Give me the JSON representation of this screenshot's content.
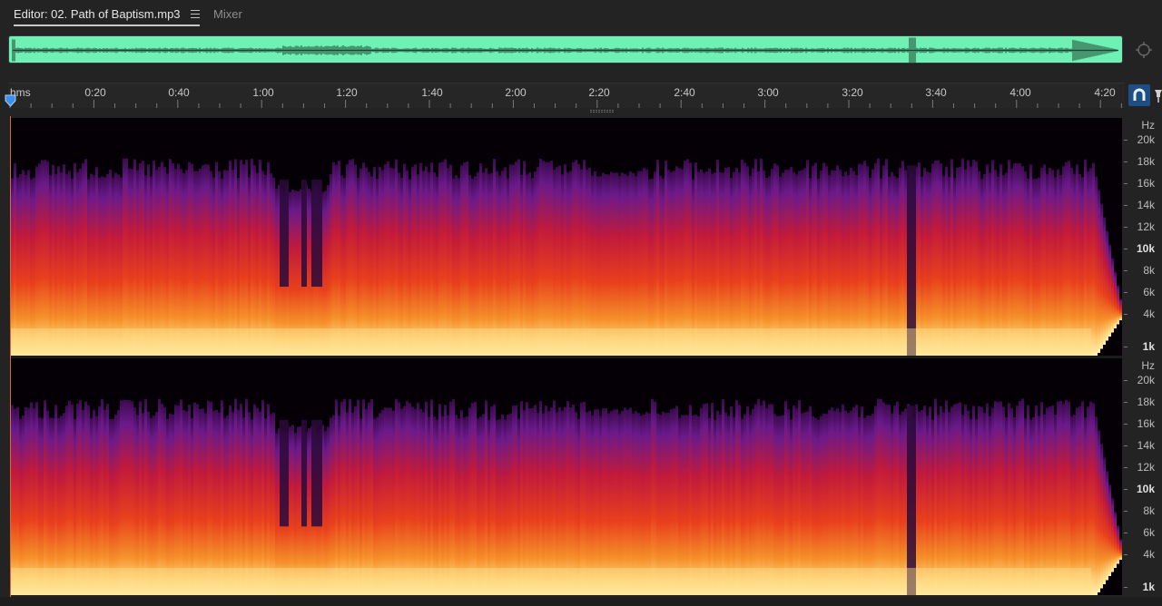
{
  "tabs": {
    "editor_label": "Editor: 02. Path of Baptism.mp3",
    "mixer_label": "Mixer"
  },
  "ruler": {
    "labels": [
      "hms",
      "0:20",
      "0:40",
      "1:00",
      "1:20",
      "1:40",
      "2:00",
      "2:20",
      "2:40",
      "3:00",
      "3:20",
      "3:40",
      "4:00",
      "4:20"
    ]
  },
  "hz_scale": {
    "unit": "Hz",
    "labels": [
      "20k",
      "18k",
      "16k",
      "14k",
      "12k",
      "10k",
      "8k",
      "6k",
      "4k",
      "1k"
    ]
  },
  "colors": {
    "overview_waveform_bg": "#6ff0b4",
    "spectral_low": "#ffe08a",
    "spectral_mid": "#e8301c",
    "spectral_high": "#6a1a8a",
    "accent_button": "#1d4f85"
  },
  "icons": {
    "tab_menu": "hamburger-menu-icon",
    "zoom": "zoom-crosshair-icon",
    "playhead": "playhead-marker-icon",
    "snap": "magnet-snap-icon"
  }
}
